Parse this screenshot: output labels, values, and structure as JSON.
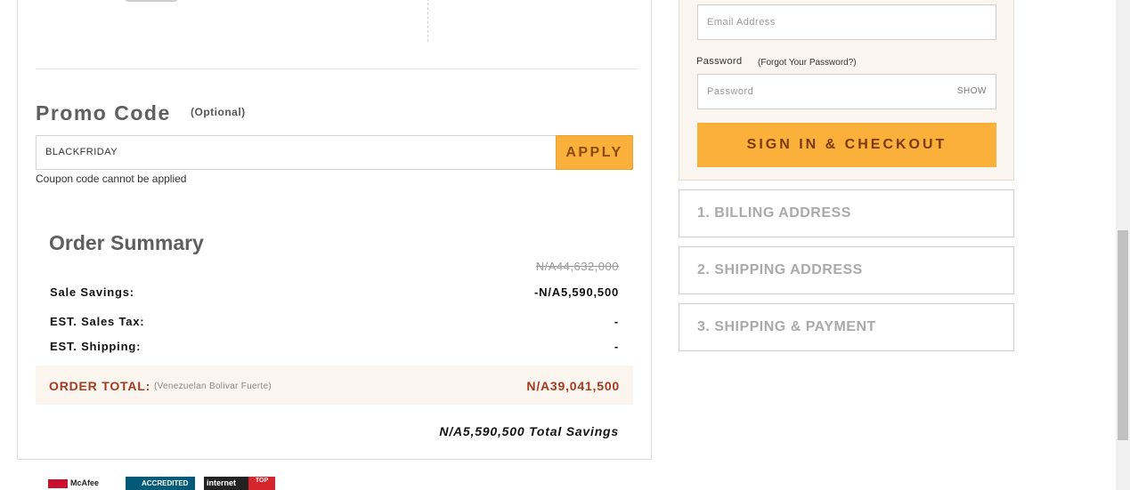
{
  "promo": {
    "title": "Promo Code",
    "optional": "(Optional)",
    "value": "BLACKFRIDAY",
    "apply_label": "APPLY",
    "error": "Coupon code cannot be applied"
  },
  "summary": {
    "title": "Order Summary",
    "original_price": "N/A44,632,000",
    "rows": [
      {
        "label": "Sale Savings:",
        "value": "-N/A5,590,500"
      },
      {
        "label": "EST. Sales Tax:",
        "value": "-"
      },
      {
        "label": "EST. Shipping:",
        "value": "-"
      }
    ],
    "total_label": "ORDER TOTAL:",
    "total_currency": "(Venezuelan Bolivar Fuerte)",
    "total_value": "N/A39,041,500",
    "total_savings": "N/A5,590,500 Total Savings"
  },
  "badges": {
    "mcafee": "McAfee",
    "bbb": "ACCREDITED",
    "internet": "internet",
    "internet_top": "TOP"
  },
  "signin": {
    "email_placeholder": "Email Address",
    "password_label": "Password",
    "forgot_link": "(Forgot Your Password?)",
    "password_placeholder": "Password",
    "show_label": "SHOW",
    "checkout_label": "SIGN IN & CHECKOUT"
  },
  "steps": [
    {
      "label": "1. BILLING ADDRESS"
    },
    {
      "label": "2. SHIPPING ADDRESS"
    },
    {
      "label": "3. SHIPPING & PAYMENT"
    }
  ],
  "colors": {
    "accent": "#fbb03b",
    "total_red": "#a53a1f",
    "panel_bg": "#fbf5f0"
  }
}
